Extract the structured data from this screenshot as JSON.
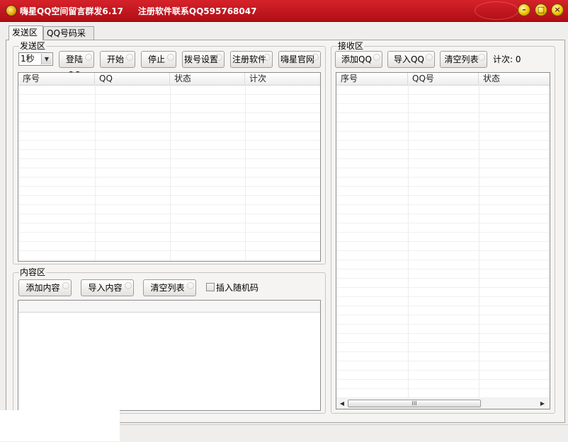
{
  "window": {
    "title": "嗨星QQ空间留言群发6.17     注册软件联系QQ595768047",
    "buttons": {
      "minimize": "–",
      "maximize": "□",
      "close": "×"
    }
  },
  "tabs": [
    {
      "label": "发送区",
      "active": true
    },
    {
      "label": "QQ号码采集",
      "active": false
    }
  ],
  "send_area": {
    "legend": "发送区",
    "interval": "1秒",
    "buttons": [
      "登陆QQ",
      "开始",
      "停止",
      "拨号设置",
      "注册软件",
      "嗨星官网"
    ],
    "columns": [
      "序号",
      "QQ",
      "状态",
      "计次"
    ]
  },
  "content_area": {
    "legend": "内容区",
    "buttons": [
      "添加内容",
      "导入内容",
      "清空列表"
    ],
    "insert_random_label": "插入随机码",
    "insert_random_checked": false
  },
  "receive_area": {
    "legend": "接收区",
    "buttons": [
      "添加QQ",
      "导入QQ",
      "清空列表"
    ],
    "count_label": "计次: 0",
    "columns": [
      "序号",
      "QQ号",
      "状态"
    ],
    "scroll_label": "III"
  },
  "colors": {
    "titlebar": "#c4161e",
    "accent": "#f2c400"
  }
}
